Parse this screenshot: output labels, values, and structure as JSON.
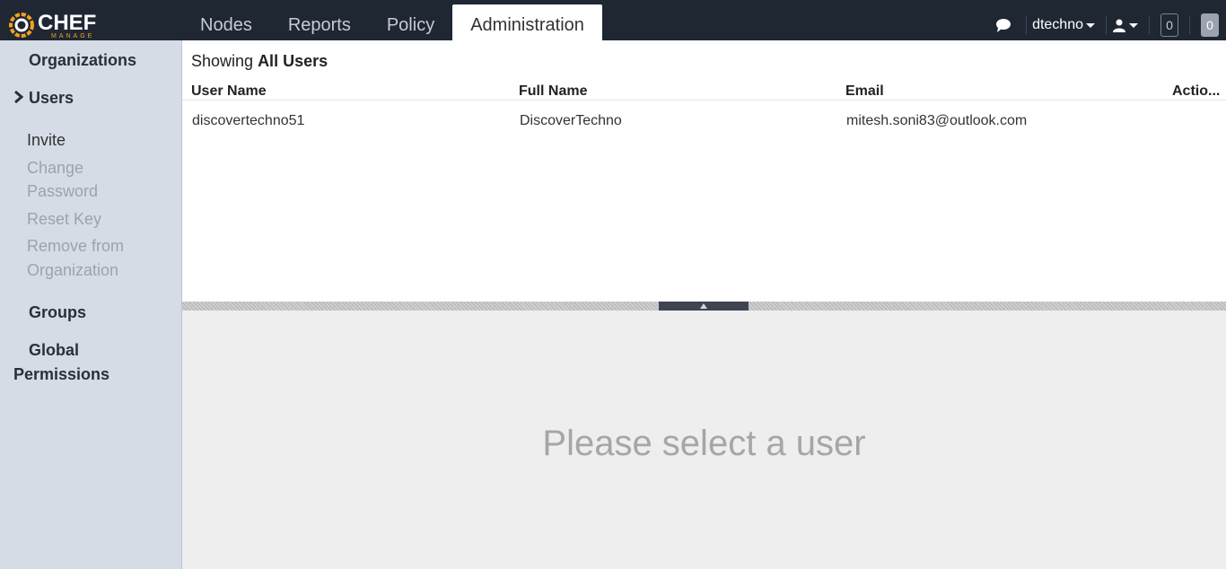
{
  "app": {
    "logo_word": "CHEF",
    "logo_sub": "MANAGE"
  },
  "nav": {
    "tabs": [
      {
        "label": "Nodes"
      },
      {
        "label": "Reports"
      },
      {
        "label": "Policy"
      },
      {
        "label": "Administration",
        "active": true
      }
    ]
  },
  "header": {
    "username": "dtechno",
    "count_a": "0",
    "count_b": "0"
  },
  "sidebar": {
    "organizations": "Organizations",
    "users": "Users",
    "invite": "Invite",
    "change_password_1": "Change",
    "change_password_2": "Password",
    "reset_key": "Reset Key",
    "remove_1": "Remove from",
    "remove_2": "Organization",
    "groups": "Groups",
    "global_1": "Global",
    "global_2": "Permissions"
  },
  "main": {
    "showing_prefix": "Showing ",
    "showing_bold": "All Users",
    "columns": [
      "User Name",
      "Full Name",
      "Email",
      "Actio..."
    ],
    "rows": [
      {
        "user_name": "discovertechno51",
        "full_name": "DiscoverTechno",
        "email": "mitesh.soni83@outlook.com"
      }
    ],
    "empty_detail": "Please select a user"
  },
  "colors": {
    "topbar": "#1f2733",
    "sidebar": "#d5dce6",
    "accent_orange": "#f2a01f",
    "lower_panel": "#eeeeee"
  }
}
